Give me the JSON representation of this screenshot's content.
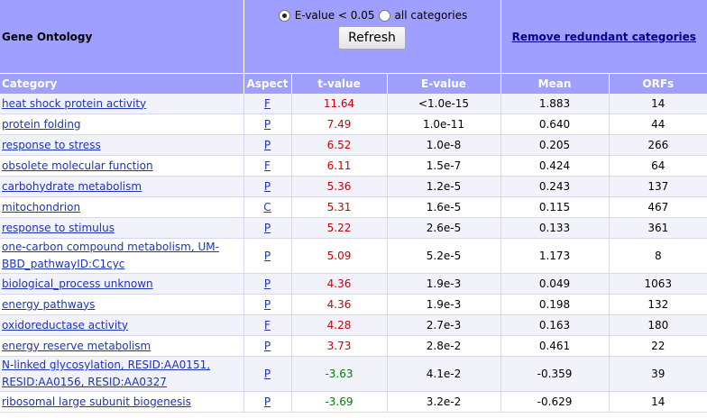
{
  "header": {
    "title": "Gene Ontology",
    "radio_evalue_label": "E-value < 0.05",
    "radio_all_label": "all categories",
    "refresh_label": "Refresh",
    "remove_redundant_label": "Remove redundant categories"
  },
  "columns": {
    "category": "Category",
    "aspect": "Aspect",
    "tvalue": "t-value",
    "evalue": "E-value",
    "mean": "Mean",
    "orfs": "ORFs"
  },
  "rows": [
    {
      "category": "heat shock protein activity",
      "aspect": "F",
      "tvalue": "11.64",
      "evalue": "<1.0e-15",
      "mean": "1.883",
      "orfs": "14"
    },
    {
      "category": "protein folding",
      "aspect": "P",
      "tvalue": "7.49",
      "evalue": "1.0e-11",
      "mean": "0.640",
      "orfs": "44"
    },
    {
      "category": "response to stress",
      "aspect": "P",
      "tvalue": "6.52",
      "evalue": "1.0e-8",
      "mean": "0.205",
      "orfs": "266"
    },
    {
      "category": "obsolete molecular function",
      "aspect": "F",
      "tvalue": "6.11",
      "evalue": "1.5e-7",
      "mean": "0.424",
      "orfs": "64"
    },
    {
      "category": "carbohydrate metabolism",
      "aspect": "P",
      "tvalue": "5.36",
      "evalue": "1.2e-5",
      "mean": "0.243",
      "orfs": "137"
    },
    {
      "category": "mitochondrion",
      "aspect": "C",
      "tvalue": "5.31",
      "evalue": "1.6e-5",
      "mean": "0.115",
      "orfs": "467"
    },
    {
      "category": "response to stimulus",
      "aspect": "P",
      "tvalue": "5.22",
      "evalue": "2.6e-5",
      "mean": "0.133",
      "orfs": "361"
    },
    {
      "category": "one-carbon compound metabolism, UM-BBD_pathwayID:C1cyc",
      "aspect": "P",
      "tvalue": "5.09",
      "evalue": "5.2e-5",
      "mean": "1.173",
      "orfs": "8"
    },
    {
      "category": "biological_process unknown",
      "aspect": "P",
      "tvalue": "4.36",
      "evalue": "1.9e-3",
      "mean": "0.049",
      "orfs": "1063"
    },
    {
      "category": "energy pathways",
      "aspect": "P",
      "tvalue": "4.36",
      "evalue": "1.9e-3",
      "mean": "0.198",
      "orfs": "132"
    },
    {
      "category": "oxidoreductase activity",
      "aspect": "F",
      "tvalue": "4.28",
      "evalue": "2.7e-3",
      "mean": "0.163",
      "orfs": "180"
    },
    {
      "category": "energy reserve metabolism",
      "aspect": "P",
      "tvalue": "3.73",
      "evalue": "2.8e-2",
      "mean": "0.461",
      "orfs": "22"
    },
    {
      "category": "N-linked glycosylation, RESID:AA0151, RESID:AA0156, RESID:AA0327",
      "aspect": "P",
      "tvalue": "-3.63",
      "evalue": "4.1e-2",
      "mean": "-0.359",
      "orfs": "39"
    },
    {
      "category": "ribosomal large subunit biogenesis",
      "aspect": "P",
      "tvalue": "-3.69",
      "evalue": "3.2e-2",
      "mean": "-0.629",
      "orfs": "14"
    }
  ],
  "colors": {
    "header_bg": "#9f9fff",
    "positive_t": "#cc0000",
    "negative_t": "#008000",
    "link": "#1f33b5"
  }
}
